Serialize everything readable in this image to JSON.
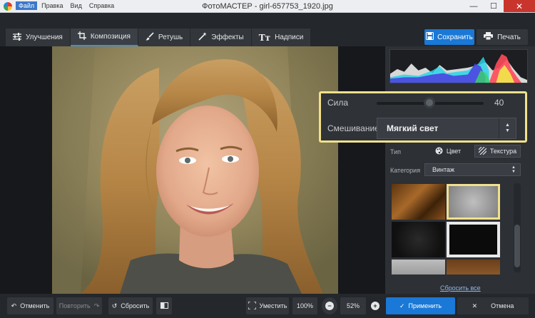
{
  "window": {
    "title": "ФотоМАСТЕР - girl-657753_1920.jpg",
    "menu": [
      "Файл",
      "Правка",
      "Вид",
      "Справка"
    ],
    "minimize": "—",
    "maximize": "☐",
    "close": "✕"
  },
  "toolbar": {
    "tabs": [
      {
        "label": "Улучшения",
        "icon": "sliders-icon"
      },
      {
        "label": "Композиция",
        "icon": "crop-icon"
      },
      {
        "label": "Ретушь",
        "icon": "brush-icon"
      },
      {
        "label": "Эффекты",
        "icon": "magic-wand-icon"
      },
      {
        "label": "Надписи",
        "icon": "text-icon"
      }
    ],
    "save_label": "Сохранить",
    "print_label": "Печать"
  },
  "panel": {
    "strength_label": "Сила",
    "strength_value": "40",
    "strength_level": 0.4,
    "blend_label": "Смешивание",
    "blend_value": "Мягкий свет",
    "type_label": "Тип",
    "type_color": "Цвет",
    "type_texture": "Текстура",
    "category_label": "Категория",
    "category_value": "Винтаж",
    "reset_all": "Сбросить все"
  },
  "bottom": {
    "undo": "Отменить",
    "redo": "Повторить",
    "reset": "Сбросить",
    "fit": "Уместить",
    "zoom_100": "100%",
    "zoom_value": "52%",
    "apply": "Применить",
    "cancel": "Отмена"
  },
  "colors": {
    "accent": "#1a78d6",
    "highlight": "#f1e08c"
  }
}
